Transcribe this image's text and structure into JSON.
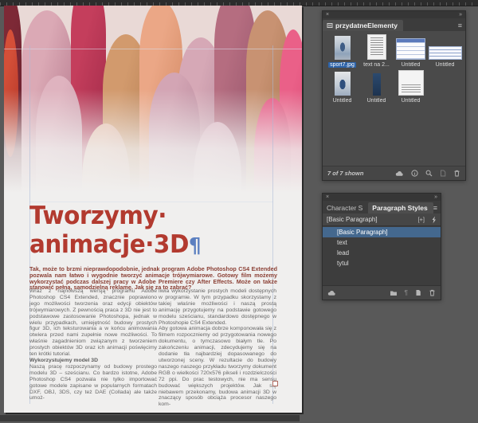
{
  "workspace": {
    "bg_color": "#595959",
    "panel_bg": "#464646",
    "selection_blue": "#44688e",
    "label_selection_blue": "#2d63a8"
  },
  "document": {
    "title_line1": "Tworzymy·",
    "title_line2": "animacje·3D",
    "pilcrow": "¶",
    "title_color": "#b23a2f",
    "lead": "Tak, może to brzmi nieprawdopodobnie, jednak program Adobe Photoshop CS4 Extended pozwala nam łatwo i wygodnie tworzyć animacje trójwymiarowe. Gotowy film możemy wykorzystać podczas dalszej pracy w Adobe Premiere czy After Effects. Może on także stanowić pełną, samodzielną reklamę. Jak się za to zabrać?",
    "columns": {
      "left": {
        "para1": "Wraz z najnowszą wersją programu Adobe Photoshop CS4 Extended, znacznie poprawiono jego możliwości tworzenia oraz edycji obiektów trójwymiarowych. Z pewnością praca z 3D nie jest to podstawowe zastosowanie Photoshopa, jednak w wielu przypadkach, umiejętność budowy prostych figur 3D, ich teksturowania a w końcu animowania otwiera przed nami zupełnie nowe możliwości. To właśnie zagadnieniom związanym z tworzeniem prostych obiektów 3D oraz ich animacji poświęcimy ten krótki tutorial.",
        "subhead": "Wykorzystujemy model 3D",
        "para2": "Naszą pracę rozpoczynamy od budowy prostego modelu 3D – sześcianu. Co bardzo istotne, Adobe Photoshop CS4 pozwala nie tylko importować gotowe modele zapisane w popularnych formatach DXF, OBJ, 3DS, czy też DAE (Collada) ale także umoż-"
      },
      "right": {
        "para1": "liwia wykorzystanie prostych modeli dostępnych w programie. W tym przypadku skorzystamy z takiej właśnie możliwości i naszą prostą animację przygotujemy na podstawie gotowego modelu sześcianu, standardowo dostępnego w Photoshopie CS4 Extended.",
        "para2": "Aby gotowa animacja dobrze komponowała się z filmem rozpoczniemy od przygotowania nowego dokumentu, o tymczasowo białym tle. Po zakończeniu animacji, zdecydujemy się na dodanie tła najbardziej dopasowanego do utworzonej sceny. W rezultacie do budowy naszego naszego przykładu tworzymy dokument RGB o wielkości 720x576 pikseli i rozdzielczości 72 ppi. Do prac testowych, nie ma sensu budować większych projektów. Jak się niebawem przekonamy, budowa animacji 3D w znaczący sposób obciąża procesor naszego kom-"
      }
    },
    "photo": {
      "description": "lipstick crayons fading to white",
      "crayons": [
        {
          "light": "#7d2936",
          "dark": "#5f1d2a"
        },
        {
          "light": "#d44f38",
          "dark": "#b03427"
        },
        {
          "light": "#dba9b5",
          "dark": "#a96a80"
        },
        {
          "light": "#c43e5c",
          "dark": "#992645"
        },
        {
          "light": "#d29a6d",
          "dark": "#aa7348"
        },
        {
          "light": "#eba786",
          "dark": "#c97f58"
        },
        {
          "light": "#d6a8b6",
          "dark": "#a87b90"
        },
        {
          "light": "#b56d80",
          "dark": "#8e4f66"
        },
        {
          "light": "#c89272",
          "dark": "#9e6c46"
        },
        {
          "light": "#ea6088",
          "dark": "#cf3a66"
        },
        {
          "light": "#dfb3bf",
          "dark": "#c08ea0"
        },
        {
          "light": "#e8bda8",
          "dark": "#cc9680"
        },
        {
          "light": "#d3a5b4",
          "dark": "#b07f94"
        },
        {
          "light": "#dcb2c0",
          "dark": "#bd8fa2"
        },
        {
          "light": "#e65a84",
          "dark": "#c23863"
        }
      ]
    }
  },
  "library_panel": {
    "tab": "przydatneElementy",
    "status": "7 of 7 shown",
    "items": [
      {
        "label": "sport7.jpg",
        "selected": true
      },
      {
        "label": "text na 2..."
      },
      {
        "label": "Untitled"
      },
      {
        "label": "Untitled"
      },
      {
        "label": "Untitled"
      },
      {
        "label": "Untitled"
      },
      {
        "label": "Untitled"
      }
    ]
  },
  "styles_panel": {
    "tab_inactive": "Character S",
    "tab_active": "Paragraph Styles",
    "current_style": "[Basic Paragraph]",
    "styles": [
      {
        "name": "[Basic Paragraph]",
        "selected": true
      },
      {
        "name": "text"
      },
      {
        "name": "lead"
      },
      {
        "name": "tytul"
      }
    ]
  },
  "chrome": {
    "close": "×",
    "collapse": "»",
    "menu": "≡",
    "new_override": "[+]",
    "clear_override": "¶"
  }
}
